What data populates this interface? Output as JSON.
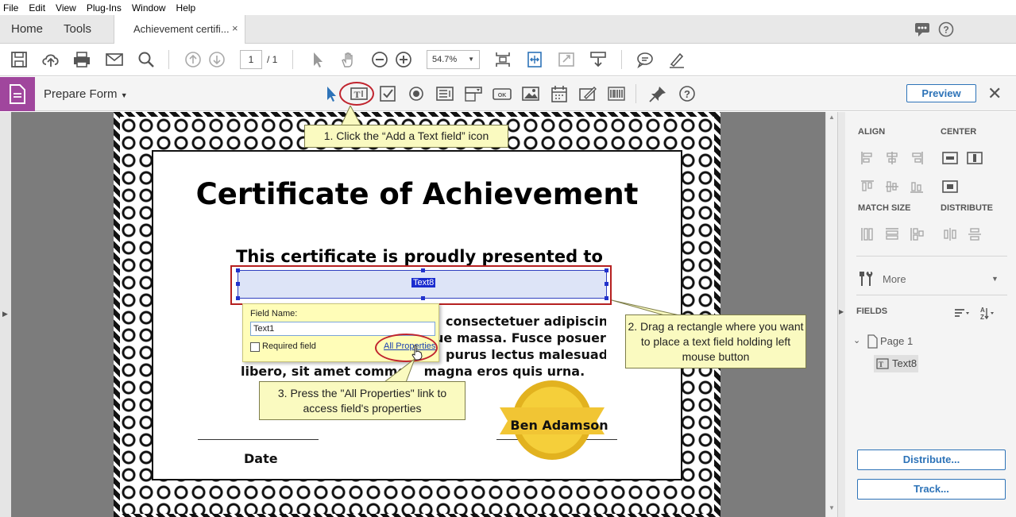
{
  "menu": [
    "File",
    "Edit",
    "View",
    "Plug-Ins",
    "Window",
    "Help"
  ],
  "tabs": {
    "home": "Home",
    "tools": "Tools",
    "document": "Achievement certifi...",
    "close": "×"
  },
  "toolbar": {
    "page_current": "1",
    "page_total": "/ 1",
    "zoom": "54.7%"
  },
  "formbar": {
    "title": "Prepare Form",
    "preview": "Preview",
    "close": "✕"
  },
  "certificate": {
    "title": "Certificate of Achievement",
    "subtitle": "This certificate is proudly presented to",
    "field_label": "Text8",
    "body_lines": [
      "consectetuer adipiscing",
      "ue massa. Fusce posuere,",
      "purus lectus malesuada",
      "libero, sit amet commo    magna eros quis urna."
    ],
    "signer": "Ben Adamson",
    "date_label": "Date"
  },
  "popup": {
    "field_name_label": "Field Name:",
    "field_name_value": "Text1",
    "required_label": "Required field",
    "all_properties": "All Properties"
  },
  "callouts": {
    "step1": "1. Click the “Add a Text field” icon",
    "step2": "2. Drag a rectangle where you want to place a text field holding left mouse button",
    "step3": "3. Press the \"All Properties\" link to access field's properties"
  },
  "right_panel": {
    "align": "ALIGN",
    "center": "CENTER",
    "match_size": "MATCH SIZE",
    "distribute": "DISTRIBUTE",
    "more": "More",
    "fields": "FIELDS",
    "page": "Page 1",
    "field_item": "Text8",
    "distribute_btn": "Distribute...",
    "track_btn": "Track..."
  }
}
